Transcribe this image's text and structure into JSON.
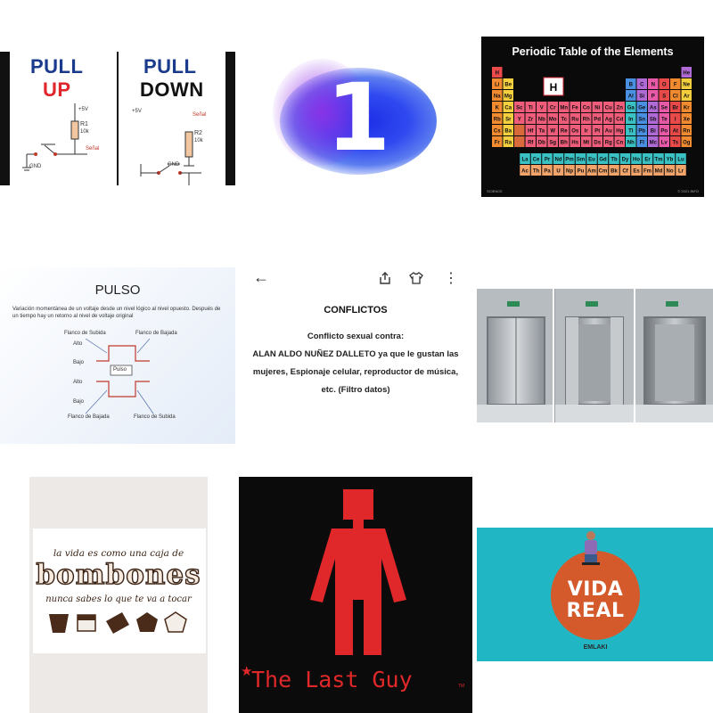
{
  "grid": {
    "pull": {
      "left": {
        "word1": "PULL",
        "word2": "UP"
      },
      "right": {
        "word1": "PULL",
        "word2": "DOWN"
      },
      "left_circuit": {
        "vcc": "+5V",
        "r_name": "R1",
        "r_value": "10k",
        "signal": "Señal",
        "gnd": "GND"
      },
      "right_circuit": {
        "vcc": "+5V",
        "r_name": "R2",
        "r_value": "10k",
        "signal": "Señal",
        "gnd": "GND"
      },
      "colors": {
        "pull": "#1a3a8c",
        "up": "#e0262b",
        "down": "#111111"
      }
    },
    "one": {
      "number": "1"
    },
    "ptable": {
      "title": "Periodic Table of the Elements",
      "periods": [
        "1",
        "2",
        "3",
        "4",
        "5",
        "6",
        "7"
      ],
      "row1": [
        "H",
        "He"
      ],
      "row2": [
        "Li",
        "Be",
        "B",
        "C",
        "N",
        "O",
        "F",
        "Ne"
      ],
      "row3": [
        "Na",
        "Mg",
        "Al",
        "Si",
        "P",
        "S",
        "Cl",
        "Ar"
      ],
      "row4": [
        "K",
        "Ca",
        "Sc",
        "Ti",
        "V",
        "Cr",
        "Mn",
        "Fe",
        "Co",
        "Ni",
        "Cu",
        "Zn",
        "Ga",
        "Ge",
        "As",
        "Se",
        "Br",
        "Kr"
      ],
      "row5": [
        "Rb",
        "Sr",
        "Y",
        "Zr",
        "Nb",
        "Mo",
        "Tc",
        "Ru",
        "Rh",
        "Pd",
        "Ag",
        "Cd",
        "In",
        "Sn",
        "Sb",
        "Te",
        "I",
        "Xe"
      ],
      "row6": [
        "Cs",
        "Ba",
        "",
        "Hf",
        "Ta",
        "W",
        "Re",
        "Os",
        "Ir",
        "Pt",
        "Au",
        "Hg",
        "Tl",
        "Pb",
        "Bi",
        "Po",
        "At",
        "Rn"
      ],
      "row7": [
        "Fr",
        "Ra",
        "",
        "Rf",
        "Db",
        "Sg",
        "Bh",
        "Hs",
        "Mt",
        "Ds",
        "Rg",
        "Cn",
        "Nh",
        "Fl",
        "Mc",
        "Lv",
        "Ts",
        "Og"
      ],
      "lanth": [
        "La",
        "Ce",
        "Pr",
        "Nd",
        "Pm",
        "Sm",
        "Eu",
        "Gd",
        "Tb",
        "Dy",
        "Ho",
        "Er",
        "Tm",
        "Yb",
        "Lu"
      ],
      "actin": [
        "Ac",
        "Th",
        "Pa",
        "U",
        "Np",
        "Pu",
        "Am",
        "Cm",
        "Bk",
        "Cf",
        "Es",
        "Fm",
        "Md",
        "No",
        "Lr"
      ],
      "featured": "H",
      "footer_left": "SCIENCE",
      "footer_right": "© 2021 INFO"
    },
    "pulso": {
      "title": "PULSO",
      "description": "Variación momentánea de un voltaje desde un nivel lógico al nivel opuesto. Después de un tiempo hay un retorno al nivel de voltaje original",
      "labels": {
        "flanco_subida_top": "Flanco de Subida",
        "flanco_bajada_top": "Flanco de Bajada",
        "alto_top": "Alto",
        "bajo_top": "Bajo",
        "pulso": "Pulso",
        "alto_bottom": "Alto",
        "bajo_bottom": "Bajo",
        "flanco_bajada_bottom": "Flanco de Bajada",
        "flanco_subida_bottom": "Flanco de Subida"
      }
    },
    "conflictos": {
      "back_icon": "←",
      "share_icon": "share-icon",
      "shirt_icon": "shirt-icon",
      "menu_icon": "⋮",
      "heading": "CONFLICTOS",
      "line1": "Conflicto sexual contra:",
      "line2": "ALAN ALDO NUÑEZ DALLETO ya que le gustan las mujeres, Espionaje celular, reproductor de música, etc. (Filtro datos)"
    },
    "elevators": {
      "count": 3
    },
    "bombones": {
      "line1": "la vida es como una caja de",
      "big": "bombones",
      "line2": "nunca sabes lo que te va a tocar"
    },
    "lastguy": {
      "title": "The Last Guy",
      "tm": "TM",
      "color": "#e0282a"
    },
    "vidareal": {
      "line1": "VIDA",
      "line2": "REAL",
      "sub": "EMLAKI",
      "bg": "#21b6c4",
      "circle": "#d45a2c"
    }
  }
}
